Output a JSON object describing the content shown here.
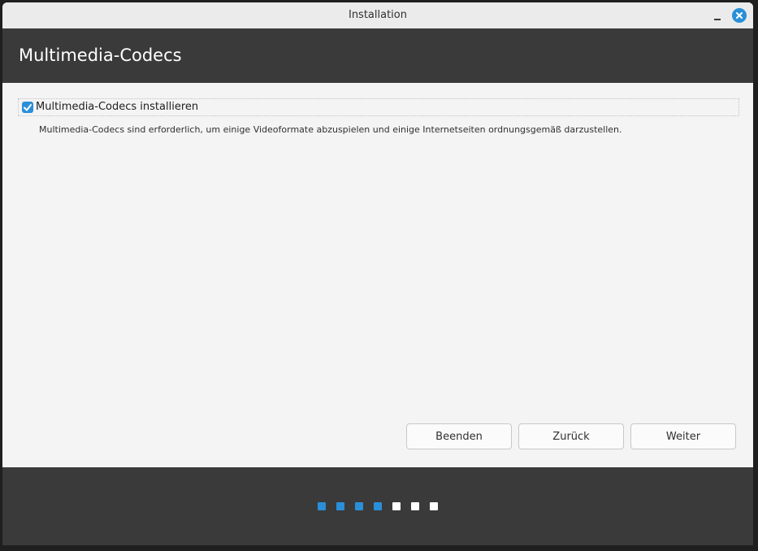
{
  "window": {
    "title": "Installation"
  },
  "header": {
    "title": "Multimedia-Codecs"
  },
  "content": {
    "checkbox_label": "Multimedia-Codecs installieren",
    "checkbox_checked": true,
    "description": "Multimedia-Codecs sind erforderlich, um einige Videoformate abzuspielen und einige Internetseiten ordnungsgemäß darzustellen."
  },
  "buttons": {
    "quit_label": "Beenden",
    "back_label": "Zurück",
    "next_label": "Weiter"
  },
  "progress": {
    "total_steps": 7,
    "completed_steps": 4,
    "active_color": "#2a8fd8",
    "inactive_color": "#ffffff"
  },
  "colors": {
    "accent": "#2a8fd8",
    "header_bg": "#3a3a3a"
  }
}
